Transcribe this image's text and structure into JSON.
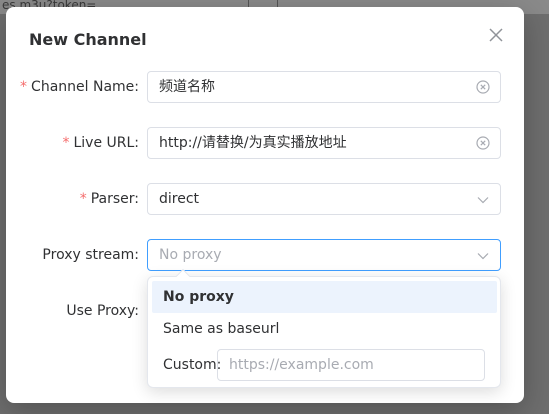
{
  "background": {
    "text": "es.m3u?token="
  },
  "dialog": {
    "title": "New Channel",
    "fields": {
      "channel_name": {
        "label": "Channel Name:",
        "value": "频道名称",
        "required": true
      },
      "live_url": {
        "label": "Live URL:",
        "value": "http://请替换/为真实播放地址",
        "required": true
      },
      "parser": {
        "label": "Parser:",
        "value": "direct",
        "required": true
      },
      "proxy_stream": {
        "label": "Proxy stream:",
        "placeholder": "No proxy",
        "required": false
      },
      "use_proxy": {
        "label": "Use Proxy:",
        "required": false
      }
    },
    "required_mark": "*",
    "proxy_dropdown": {
      "options": [
        "No proxy",
        "Same as baseurl"
      ],
      "selected": "No proxy",
      "custom_label": "Custom:",
      "custom_placeholder": "https://example.com"
    }
  },
  "colors": {
    "accent": "#409eff",
    "required": "#f56c6c",
    "active_option_bg": "#ecf3fd"
  },
  "icons": {
    "close": "close-icon",
    "clear": "clear-icon",
    "chevron": "chevron-down-icon"
  }
}
